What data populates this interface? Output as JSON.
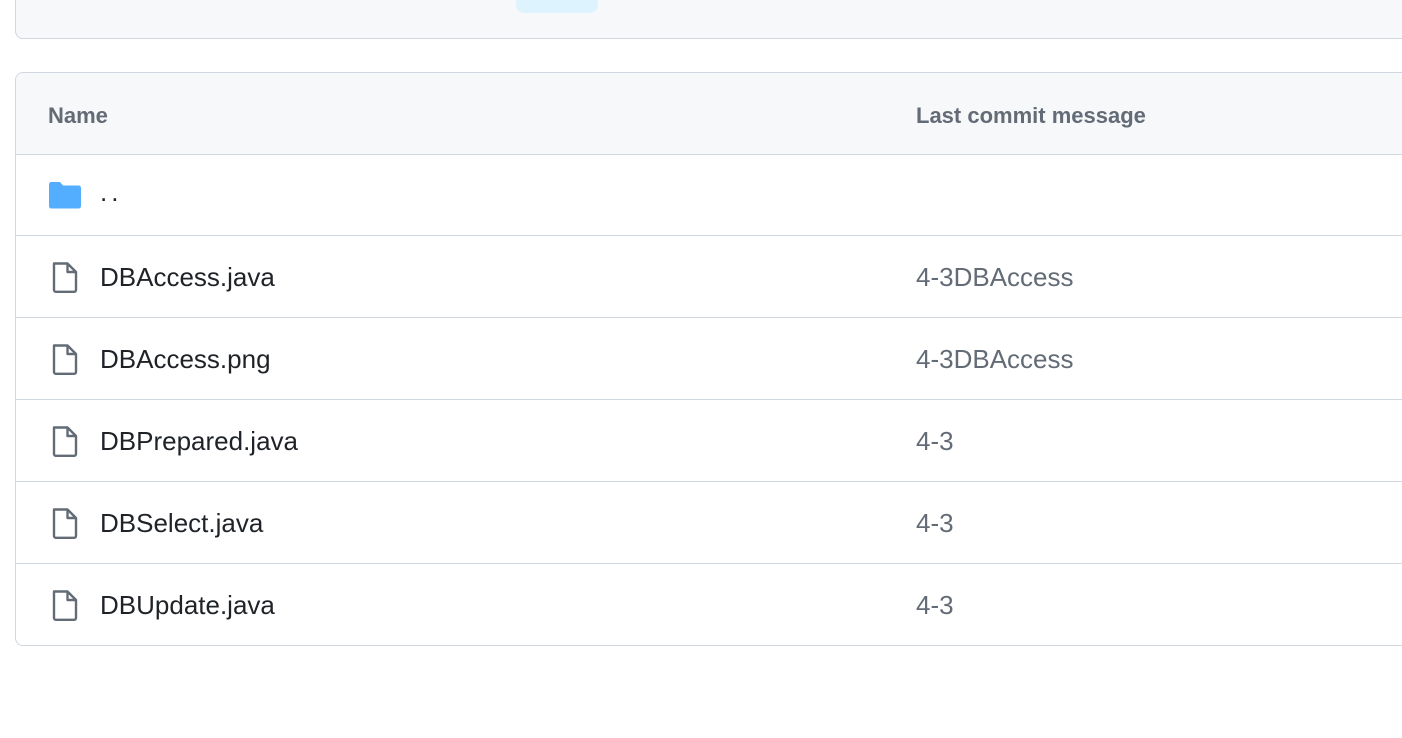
{
  "colors": {
    "border": "#d0d7de",
    "header_bg": "#f6f8fa",
    "folder_icon": "#54aeff",
    "muted_text": "#636c76",
    "primary_text": "#1f2328"
  },
  "table": {
    "headers": {
      "name": "Name",
      "message": "Last commit message"
    },
    "parent_row": {
      "label": "..",
      "icon": "folder-icon"
    },
    "rows": [
      {
        "name": "DBAccess.java",
        "message": "4-3DBAccess",
        "icon": "file-icon"
      },
      {
        "name": "DBAccess.png",
        "message": "4-3DBAccess",
        "icon": "file-icon"
      },
      {
        "name": "DBPrepared.java",
        "message": "4-3",
        "icon": "file-icon"
      },
      {
        "name": "DBSelect.java",
        "message": "4-3",
        "icon": "file-icon"
      },
      {
        "name": "DBUpdate.java",
        "message": "4-3",
        "icon": "file-icon"
      }
    ]
  }
}
